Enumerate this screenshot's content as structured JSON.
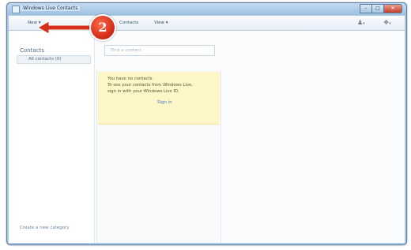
{
  "window": {
    "title": "Windows Live Contacts",
    "controls": {
      "minimize": "–",
      "maximize": "□",
      "close": "✕"
    }
  },
  "toolbar": {
    "menus": [
      "New ▾",
      "Contacts",
      "View ▾"
    ],
    "icons": [
      "user-icon",
      "help-icon"
    ]
  },
  "sidebar": {
    "title": "Contacts",
    "all_contacts": "All contacts (0)",
    "create_category": "Create a new category"
  },
  "search": {
    "placeholder": "Find a contact"
  },
  "notice": {
    "lines": [
      "You have no contacts.",
      "To see your contacts from Windows Live,",
      "sign in with your Windows Live ID."
    ],
    "link": "Sign in"
  },
  "callout": {
    "number": "2",
    "color": "#d6301c"
  }
}
